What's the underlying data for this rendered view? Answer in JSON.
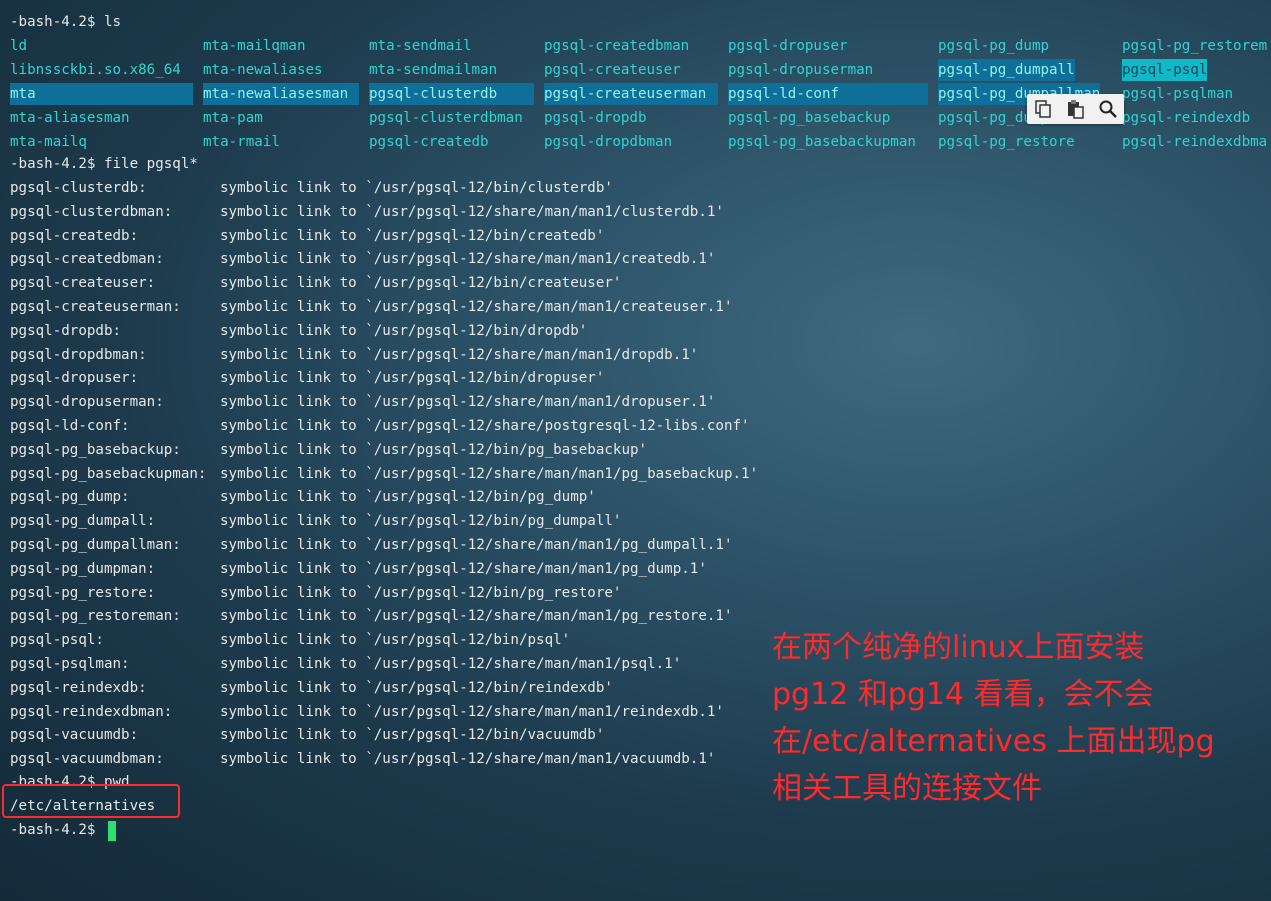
{
  "prompt_line_1": "-bash-4.2$ ls",
  "ls_rows": [
    [
      "ld",
      "mta-mailqman",
      "mta-sendmail",
      "pgsql-createdbman",
      "pgsql-dropuser",
      "pgsql-pg_dump",
      "pgsql-pg_restorem"
    ],
    [
      "libnssckbi.so.x86_64",
      "mta-newaliases",
      "mta-sendmailman",
      "pgsql-createuser",
      "pgsql-dropuserman",
      "pgsql-pg_dumpall",
      "pgsql-psql"
    ],
    [
      "mta",
      "mta-newaliasesman",
      "pgsql-clusterdb",
      "pgsql-createuserman",
      "pgsql-ld-conf",
      "pgsql-pg_dumpallman",
      "pgsql-psqlman"
    ],
    [
      "mta-aliasesman",
      "mta-pam",
      "pgsql-clusterdbman",
      "pgsql-dropdb",
      "pgsql-pg_basebackup",
      "pgsql-pg_dumpman",
      "pgsql-reindexdb"
    ],
    [
      "mta-mailq",
      "mta-rmail",
      "pgsql-createdb",
      "pgsql-dropdbman",
      "pgsql-pg_basebackupman",
      "pgsql-pg_restore",
      "pgsql-reindexdbma"
    ]
  ],
  "prompt_line_2": "-bash-4.2$ file pgsql*",
  "file_rows": [
    {
      "name": "pgsql-clusterdb:",
      "desc": "symbolic link to `/usr/pgsql-12/bin/clusterdb'"
    },
    {
      "name": "pgsql-clusterdbman:",
      "desc": "symbolic link to `/usr/pgsql-12/share/man/man1/clusterdb.1'"
    },
    {
      "name": "pgsql-createdb:",
      "desc": "symbolic link to `/usr/pgsql-12/bin/createdb'"
    },
    {
      "name": "pgsql-createdbman:",
      "desc": "symbolic link to `/usr/pgsql-12/share/man/man1/createdb.1'"
    },
    {
      "name": "pgsql-createuser:",
      "desc": "symbolic link to `/usr/pgsql-12/bin/createuser'"
    },
    {
      "name": "pgsql-createuserman:",
      "desc": "symbolic link to `/usr/pgsql-12/share/man/man1/createuser.1'"
    },
    {
      "name": "pgsql-dropdb:",
      "desc": "symbolic link to `/usr/pgsql-12/bin/dropdb'"
    },
    {
      "name": "pgsql-dropdbman:",
      "desc": "symbolic link to `/usr/pgsql-12/share/man/man1/dropdb.1'"
    },
    {
      "name": "pgsql-dropuser:",
      "desc": "symbolic link to `/usr/pgsql-12/bin/dropuser'"
    },
    {
      "name": "pgsql-dropuserman:",
      "desc": "symbolic link to `/usr/pgsql-12/share/man/man1/dropuser.1'"
    },
    {
      "name": "pgsql-ld-conf:",
      "desc": "symbolic link to `/usr/pgsql-12/share/postgresql-12-libs.conf'"
    },
    {
      "name": "pgsql-pg_basebackup:",
      "desc": "symbolic link to `/usr/pgsql-12/bin/pg_basebackup'"
    },
    {
      "name": "pgsql-pg_basebackupman:",
      "desc": "symbolic link to `/usr/pgsql-12/share/man/man1/pg_basebackup.1'"
    },
    {
      "name": "pgsql-pg_dump:",
      "desc": "symbolic link to `/usr/pgsql-12/bin/pg_dump'"
    },
    {
      "name": "pgsql-pg_dumpall:",
      "desc": "symbolic link to `/usr/pgsql-12/bin/pg_dumpall'"
    },
    {
      "name": "pgsql-pg_dumpallman:",
      "desc": "symbolic link to `/usr/pgsql-12/share/man/man1/pg_dumpall.1'"
    },
    {
      "name": "pgsql-pg_dumpman:",
      "desc": "symbolic link to `/usr/pgsql-12/share/man/man1/pg_dump.1'"
    },
    {
      "name": "pgsql-pg_restore:",
      "desc": "symbolic link to `/usr/pgsql-12/bin/pg_restore'"
    },
    {
      "name": "pgsql-pg_restoreman:",
      "desc": "symbolic link to `/usr/pgsql-12/share/man/man1/pg_restore.1'"
    },
    {
      "name": "pgsql-psql:",
      "desc": "symbolic link to `/usr/pgsql-12/bin/psql'"
    },
    {
      "name": "pgsql-psqlman:",
      "desc": "symbolic link to `/usr/pgsql-12/share/man/man1/psql.1'"
    },
    {
      "name": "pgsql-reindexdb:",
      "desc": "symbolic link to `/usr/pgsql-12/bin/reindexdb'"
    },
    {
      "name": "pgsql-reindexdbman:",
      "desc": "symbolic link to `/usr/pgsql-12/share/man/man1/reindexdb.1'"
    },
    {
      "name": "pgsql-vacuumdb:",
      "desc": "symbolic link to `/usr/pgsql-12/bin/vacuumdb'"
    },
    {
      "name": "pgsql-vacuumdbman:",
      "desc": "symbolic link to `/usr/pgsql-12/share/man/man1/vacuumdb.1'"
    }
  ],
  "prompt_line_3": "-bash-4.2$ pwd",
  "pwd_output": "/etc/alternatives",
  "prompt_line_4": "-bash-4.2$ ",
  "annotation_lines": [
    "在两个纯净的linux上面安装",
    "pg12 和pg14 看看，会不会",
    "在/etc/alternatives 上面出现pg",
    "相关工具的连接文件"
  ],
  "toolbar_icons": [
    "copy-icon",
    "paste-icon",
    "search-icon"
  ],
  "colors": {
    "ls_text": "#2fd5d0",
    "highlight_dark": "#0f6f98",
    "highlight_light": "#11b8c6",
    "annotation": "#ff2a2a",
    "cursor": "#2ee06a"
  }
}
